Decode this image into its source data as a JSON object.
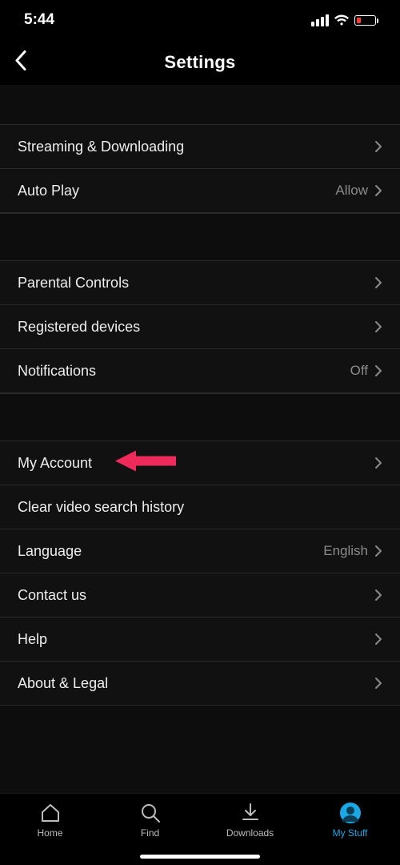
{
  "status": {
    "time": "5:44"
  },
  "header": {
    "title": "Settings"
  },
  "groups": [
    {
      "rows": [
        {
          "key": "streaming",
          "label": "Streaming & Downloading",
          "value": "",
          "chevron": true
        },
        {
          "key": "autoplay",
          "label": "Auto Play",
          "value": "Allow",
          "chevron": true
        }
      ]
    },
    {
      "rows": [
        {
          "key": "parental",
          "label": "Parental Controls",
          "value": "",
          "chevron": true
        },
        {
          "key": "devices",
          "label": "Registered devices",
          "value": "",
          "chevron": true
        },
        {
          "key": "notifications",
          "label": "Notifications",
          "value": "Off",
          "chevron": true
        }
      ]
    },
    {
      "rows": [
        {
          "key": "account",
          "label": "My Account",
          "value": "",
          "chevron": true,
          "annotated": true
        },
        {
          "key": "clear-history",
          "label": "Clear video search history",
          "value": "",
          "chevron": false
        },
        {
          "key": "language",
          "label": "Language",
          "value": "English",
          "chevron": true
        },
        {
          "key": "contact",
          "label": "Contact us",
          "value": "",
          "chevron": true
        },
        {
          "key": "help",
          "label": "Help",
          "value": "",
          "chevron": true
        },
        {
          "key": "about",
          "label": "About & Legal",
          "value": "",
          "chevron": true
        }
      ]
    }
  ],
  "tabs": {
    "home": "Home",
    "find": "Find",
    "downloads": "Downloads",
    "mystuff": "My Stuff"
  },
  "active_tab": "mystuff"
}
